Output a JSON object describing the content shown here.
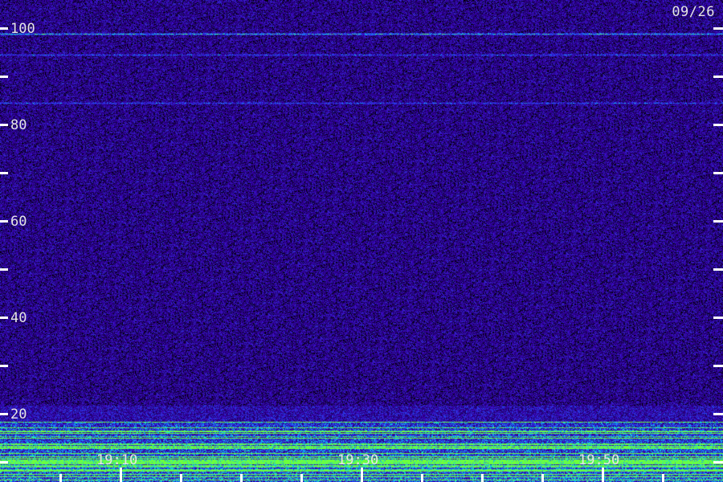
{
  "chart_data": {
    "type": "heatmap",
    "date_label": "09/26",
    "y_axis": {
      "min": 0,
      "max": 100,
      "tick_labels": [
        "20",
        "40",
        "60",
        "80",
        "100"
      ],
      "tick_values": [
        20,
        40,
        60,
        80,
        100
      ],
      "minor_tick_values": [
        0,
        10,
        30,
        50,
        70,
        90
      ]
    },
    "x_axis": {
      "tick_labels": [
        "19:10",
        "19:30",
        "19:50"
      ],
      "tick_minutes": [
        10,
        30,
        50
      ],
      "start_minute": 0,
      "end_minute": 60,
      "minor_tick_step": 5
    },
    "colormap": [
      "#000000",
      "#1a0060",
      "#3c1cd8",
      "#2a7cff",
      "#20e0e0",
      "#70ff40"
    ],
    "features": [
      {
        "type": "horizontal_line",
        "y": 98.8,
        "intensity": "medium"
      },
      {
        "type": "horizontal_line",
        "y": 84.5,
        "intensity": "weak"
      },
      {
        "type": "horizontal_line",
        "y": 94.5,
        "intensity": "weak"
      },
      {
        "type": "band",
        "y_from": 0,
        "y_to": 18.5,
        "intensity": "strong"
      }
    ]
  }
}
